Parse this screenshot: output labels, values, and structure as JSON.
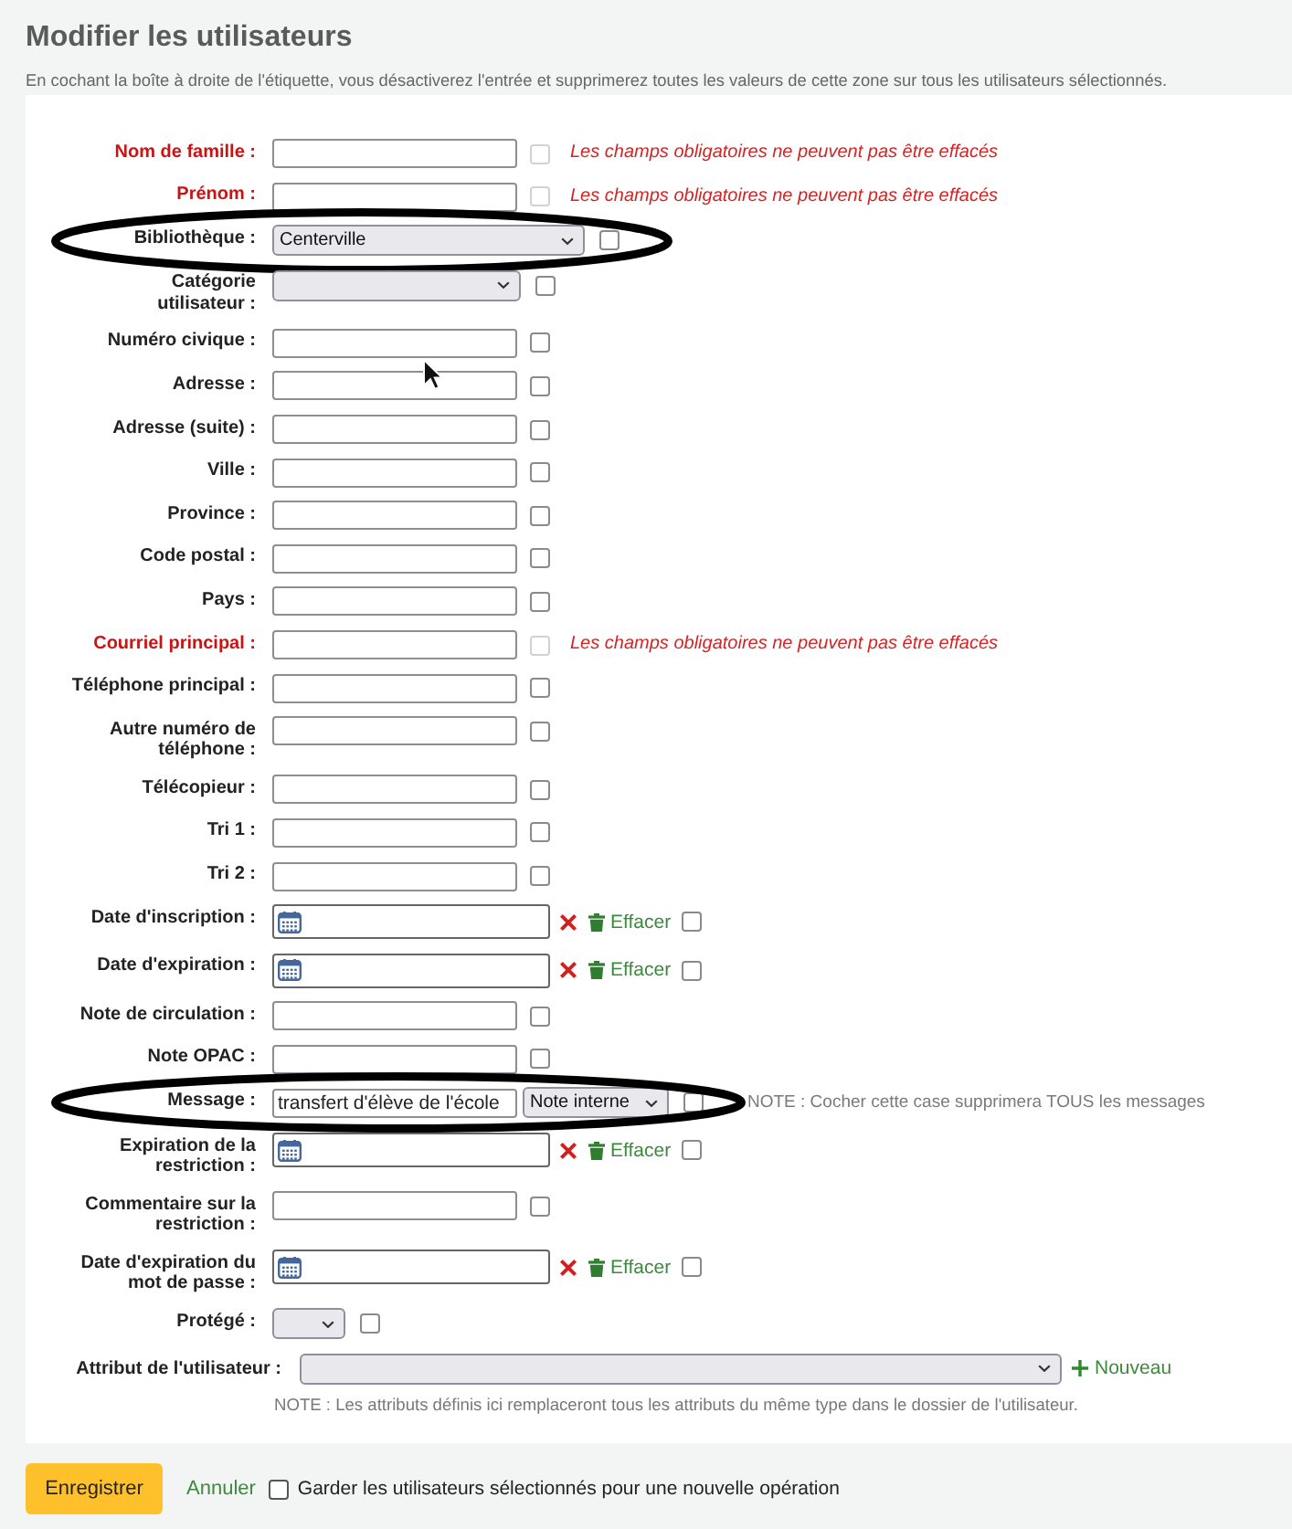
{
  "header": {
    "title": "Modifier les utilisateurs",
    "description": "En cochant la boîte à droite de l'étiquette, vous désactiverez l'entrée et supprimerez toutes les valeurs de cette zone sur tous les utilisateurs sélectionnés."
  },
  "fields": [
    {
      "label": "Nom de famille :",
      "required": true,
      "kind": "text",
      "clear_box": {
        "checked": false,
        "disabled": true
      },
      "note": {
        "kind": "warning",
        "text": "Les champs obligatoires ne peuvent pas être effacés"
      },
      "highlighted": false
    },
    {
      "label": "Prénom :",
      "required": true,
      "kind": "text",
      "clear_box": {
        "checked": false,
        "disabled": true
      },
      "note": {
        "kind": "warning",
        "text": "Les champs obligatoires ne peuvent pas être effacés"
      },
      "highlighted": false
    },
    {
      "label": "Bibliothèque :",
      "required": false,
      "kind": "dropdown",
      "value": "Centerville",
      "clear_box": {
        "checked": false,
        "disabled": false
      },
      "highlighted": true
    },
    {
      "label": "Catégorie utilisateur :",
      "required": false,
      "kind": "select",
      "clear_box": {
        "checked": false,
        "disabled": false
      },
      "highlighted": false
    },
    {
      "label": "Numéro civique :",
      "required": false,
      "kind": "text",
      "clear_box": {
        "checked": false,
        "disabled": false
      },
      "highlighted": false
    },
    {
      "label": "Adresse :",
      "required": false,
      "kind": "text",
      "clear_box": {
        "checked": false,
        "disabled": false
      },
      "highlighted": false
    },
    {
      "label": "Adresse (suite) :",
      "required": false,
      "kind": "text",
      "clear_box": {
        "checked": false,
        "disabled": false
      },
      "highlighted": false
    },
    {
      "label": "Ville :",
      "required": false,
      "kind": "text",
      "clear_box": {
        "checked": false,
        "disabled": false
      },
      "highlighted": false
    },
    {
      "label": "Province :",
      "required": false,
      "kind": "text",
      "clear_box": {
        "checked": false,
        "disabled": false
      },
      "highlighted": false
    },
    {
      "label": "Code postal :",
      "required": false,
      "kind": "text",
      "clear_box": {
        "checked": false,
        "disabled": false
      },
      "highlighted": false
    },
    {
      "label": "Pays :",
      "required": false,
      "kind": "text",
      "clear_box": {
        "checked": false,
        "disabled": false
      },
      "highlighted": false
    },
    {
      "label": "Courriel principal :",
      "required": true,
      "kind": "text",
      "clear_box": {
        "checked": false,
        "disabled": true
      },
      "note": {
        "kind": "warning",
        "text": "Les champs obligatoires ne peuvent pas être effacés"
      },
      "highlighted": false
    },
    {
      "label": "Téléphone principal :",
      "required": false,
      "kind": "text",
      "clear_box": {
        "checked": false,
        "disabled": false
      },
      "highlighted": false
    },
    {
      "label": "Autre numéro de téléphone :",
      "required": false,
      "kind": "text",
      "clear_box": {
        "checked": false,
        "disabled": false
      },
      "highlighted": false
    },
    {
      "label": "Télécopieur :",
      "required": false,
      "kind": "text",
      "clear_box": {
        "checked": false,
        "disabled": false
      },
      "highlighted": false
    },
    {
      "label": "Tri 1 :",
      "required": false,
      "kind": "text",
      "clear_box": {
        "checked": false,
        "disabled": false
      },
      "highlighted": false
    },
    {
      "label": "Tri 2 :",
      "required": false,
      "kind": "text",
      "clear_box": {
        "checked": false,
        "disabled": false
      },
      "highlighted": false
    },
    {
      "label": "Date d'inscription :",
      "required": false,
      "kind": "date",
      "clear_link": "Effacer",
      "clear_box": {
        "checked": false,
        "disabled": false
      },
      "highlighted": false
    },
    {
      "label": "Date d'expiration :",
      "required": false,
      "kind": "date",
      "clear_link": "Effacer",
      "clear_box": {
        "checked": false,
        "disabled": false
      },
      "highlighted": false
    },
    {
      "label": "Note de circulation :",
      "required": false,
      "kind": "text",
      "clear_box": {
        "checked": false,
        "disabled": false
      },
      "highlighted": false
    },
    {
      "label": "Note OPAC :",
      "required": false,
      "kind": "text",
      "clear_box": {
        "checked": false,
        "disabled": false
      },
      "highlighted": false
    },
    {
      "label": "Message :",
      "required": false,
      "kind": "message",
      "value": "transfert d'élève de l'école",
      "message_type": "Note interne",
      "clear_box": {
        "checked": false,
        "disabled": false
      },
      "note": {
        "kind": "hint",
        "text": "NOTE : Cocher cette case supprimera TOUS les messages"
      },
      "highlighted": true
    },
    {
      "label": "Expiration de la restriction :",
      "required": false,
      "kind": "date",
      "clear_link": "Effacer",
      "clear_box": {
        "checked": false,
        "disabled": false
      },
      "highlighted": false
    },
    {
      "label": "Commentaire sur la restriction :",
      "required": false,
      "kind": "text",
      "clear_box": {
        "checked": false,
        "disabled": false
      },
      "highlighted": false
    },
    {
      "label": "Date d'expiration du mot de passe :",
      "required": false,
      "kind": "date",
      "clear_link": "Effacer",
      "clear_box": {
        "checked": false,
        "disabled": false
      },
      "highlighted": false
    },
    {
      "label": "Protégé :",
      "required": false,
      "kind": "flag",
      "clear_box": {
        "checked": false,
        "disabled": false
      },
      "highlighted": false
    }
  ],
  "attribute": {
    "label": "Attribut de l'utilisateur :",
    "new_link": "Nouveau",
    "note": "NOTE : Les attributs définis ici remplaceront tous les attributs du même type dans le dossier de l'utilisateur."
  },
  "footer": {
    "save_button": "Enregistrer",
    "cancel_link": "Annuler",
    "keep_selection": {
      "label": "Garder les utilisateurs sélectionnés pour une nouvelle opération",
      "checked": false
    }
  }
}
